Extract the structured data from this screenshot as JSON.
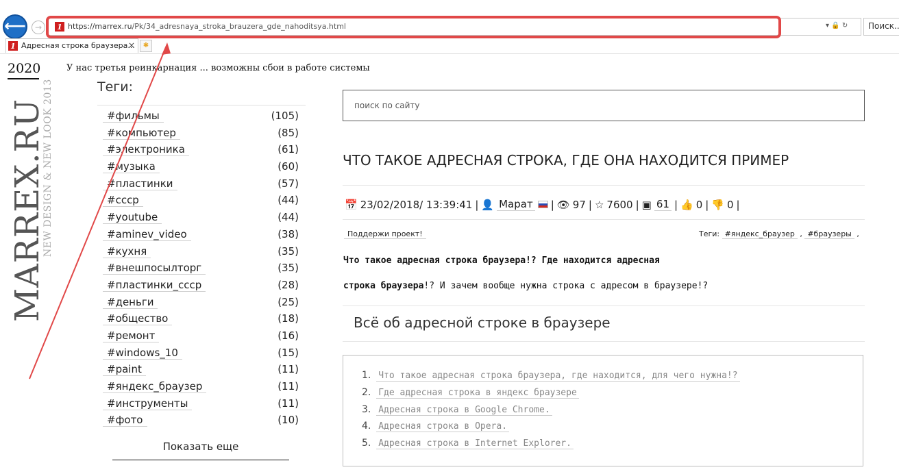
{
  "browser": {
    "url_host": "https://marrex.ru",
    "url_path": "/Pk/34_adresnaya_stroka_brauzera_gde_nahoditsya.html",
    "favicon_text": "1",
    "search_placeholder": "Поиск...",
    "tab_title": "Адресная строка браузера...",
    "tab_close": "×"
  },
  "header": {
    "year": "2020",
    "notice": "У нас третья реинкарнация ... возможны сбои в работе системы",
    "logo_main": "MARREX.RU",
    "logo_sub": "NEW DESIGN & NEW LOOK 2013"
  },
  "sidebar": {
    "title": "Теги:",
    "tags": [
      {
        "name": "#фильмы",
        "count": "(105)"
      },
      {
        "name": "#компьютер",
        "count": "(85)"
      },
      {
        "name": "#электроника",
        "count": "(61)"
      },
      {
        "name": "#музыка",
        "count": "(60)"
      },
      {
        "name": "#пластинки",
        "count": "(57)"
      },
      {
        "name": "#ссср",
        "count": "(44)"
      },
      {
        "name": "#youtube",
        "count": "(44)"
      },
      {
        "name": "#aminev_video",
        "count": "(38)"
      },
      {
        "name": "#кухня",
        "count": "(35)"
      },
      {
        "name": "#внешпосылторг",
        "count": "(35)"
      },
      {
        "name": "#пластинки_ссср",
        "count": "(28)"
      },
      {
        "name": "#деньги",
        "count": "(25)"
      },
      {
        "name": "#общество",
        "count": "(18)"
      },
      {
        "name": "#ремонт",
        "count": "(16)"
      },
      {
        "name": "#windows_10",
        "count": "(15)"
      },
      {
        "name": "#paint",
        "count": "(11)"
      },
      {
        "name": "#яндекс_браузер",
        "count": "(11)"
      },
      {
        "name": "#инструменты",
        "count": "(11)"
      },
      {
        "name": "#фото",
        "count": "(10)"
      }
    ],
    "show_more": "Показать еще"
  },
  "main": {
    "search_placeholder": "поиск по сайту",
    "article_title": "ЧТО ТАКОЕ АДРЕСНАЯ СТРОКА, ГДЕ ОНА НАХОДИТСЯ ПРИМЕР",
    "meta": {
      "datetime": "23/02/2018/ 13:39:41",
      "author": "Марат",
      "views": "97",
      "rating": "7600",
      "comments": "61",
      "likes": "0",
      "dislikes": "0"
    },
    "support_label": "Поддержи проект!",
    "tags_label": "Теги:",
    "article_tags": [
      "#яндекс_браузер",
      "#браузеры"
    ],
    "intro_line1": "Что такое адресная строка браузера!? Где находится адресная",
    "intro_line2_bold": "строка браузера",
    "intro_line2_rest": "!? И зачем вообще нужна строка с адресом в браузере!?",
    "section_title": "Всё об адресной строке в браузере",
    "toc": [
      {
        "num": "1.",
        "label": "Что такое адресная строка браузера, где находится, для чего нужна!?"
      },
      {
        "num": "2.",
        "label": "Где адресная строка в яндекс браузере"
      },
      {
        "num": "3.",
        "label": "Адресная строка в Google Chrome."
      },
      {
        "num": "4.",
        "label": "Адресная строка в Opera."
      },
      {
        "num": "5.",
        "label": "Адресная строка в Internet Explorer."
      }
    ]
  },
  "colors": {
    "highlight": "#e14848",
    "back_button": "#1f6fc6"
  }
}
